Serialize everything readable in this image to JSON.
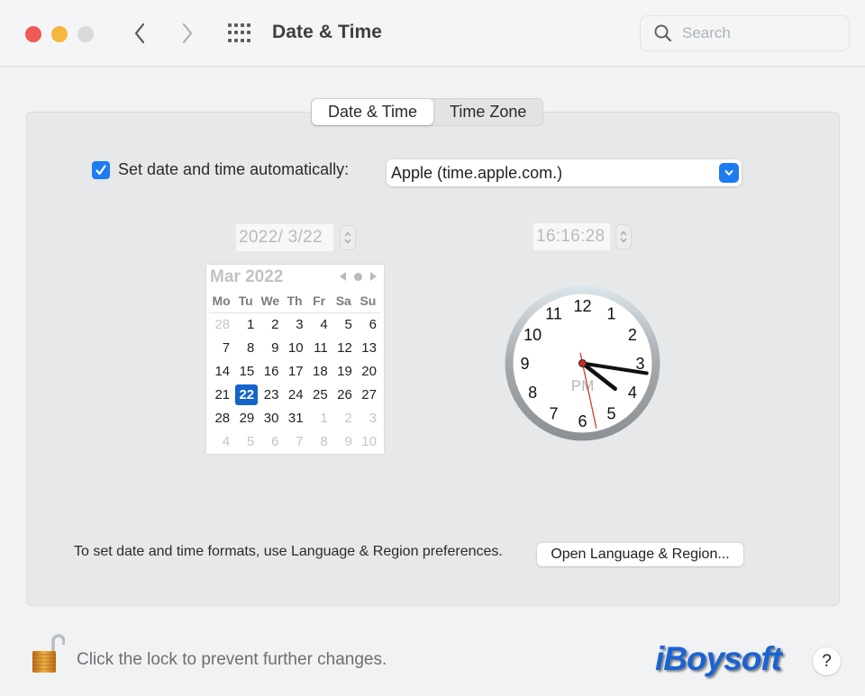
{
  "window": {
    "title": "Date & Time",
    "traffic_lights": [
      "close",
      "minimize",
      "zoom"
    ],
    "nav": {
      "back": "back-chevron",
      "forward": "forward-chevron",
      "grid": "show-all-grid"
    }
  },
  "search": {
    "placeholder": "Search",
    "value": "",
    "icon": "search-icon"
  },
  "tabs": [
    {
      "label": "Date & Time",
      "active": true
    },
    {
      "label": "Time Zone",
      "active": false
    }
  ],
  "auto": {
    "checked": true,
    "label": "Set date and time automatically:",
    "server": "Apple (time.apple.com.)"
  },
  "date_field": {
    "value": "2022/  3/22"
  },
  "time_field": {
    "value": "16:16:28"
  },
  "calendar": {
    "month_label": "Mar 2022",
    "weekdays": [
      "Mo",
      "Tu",
      "We",
      "Th",
      "Fr",
      "Sa",
      "Su"
    ],
    "days": [
      {
        "d": "28",
        "muted": true
      },
      {
        "d": "1"
      },
      {
        "d": "2"
      },
      {
        "d": "3"
      },
      {
        "d": "4"
      },
      {
        "d": "5"
      },
      {
        "d": "6"
      },
      {
        "d": "7"
      },
      {
        "d": "8"
      },
      {
        "d": "9"
      },
      {
        "d": "10"
      },
      {
        "d": "11"
      },
      {
        "d": "12"
      },
      {
        "d": "13"
      },
      {
        "d": "14"
      },
      {
        "d": "15"
      },
      {
        "d": "16"
      },
      {
        "d": "17"
      },
      {
        "d": "18"
      },
      {
        "d": "19"
      },
      {
        "d": "20"
      },
      {
        "d": "21"
      },
      {
        "d": "22",
        "selected": true
      },
      {
        "d": "23"
      },
      {
        "d": "24"
      },
      {
        "d": "25"
      },
      {
        "d": "26"
      },
      {
        "d": "27"
      },
      {
        "d": "28"
      },
      {
        "d": "29"
      },
      {
        "d": "30"
      },
      {
        "d": "31"
      },
      {
        "d": "1",
        "muted": true
      },
      {
        "d": "2",
        "muted": true
      },
      {
        "d": "3",
        "muted": true
      },
      {
        "d": "4",
        "muted": true
      },
      {
        "d": "5",
        "muted": true
      },
      {
        "d": "6",
        "muted": true
      },
      {
        "d": "7",
        "muted": true
      },
      {
        "d": "8",
        "muted": true
      },
      {
        "d": "9",
        "muted": true
      },
      {
        "d": "10",
        "muted": true
      }
    ]
  },
  "clock": {
    "numbers": [
      "12",
      "1",
      "2",
      "3",
      "4",
      "5",
      "6",
      "7",
      "8",
      "9",
      "10",
      "11"
    ],
    "period": "PM",
    "hour": 16,
    "minute": 16,
    "second": 28
  },
  "formats": {
    "text": "To set date and time formats, use Language & Region preferences.",
    "button": "Open Language & Region..."
  },
  "footer": {
    "lock_text": "Click the lock to prevent further changes.",
    "brand": "iBoysoft",
    "help": "?"
  },
  "colors": {
    "accent": "#1f7cf0",
    "selected_day": "#1564c9",
    "close": "#ee5a55",
    "minimize": "#f6b73e",
    "zoom": "#d9dadc",
    "second_hand": "#d93a2e",
    "brand": "#1a63d3"
  }
}
